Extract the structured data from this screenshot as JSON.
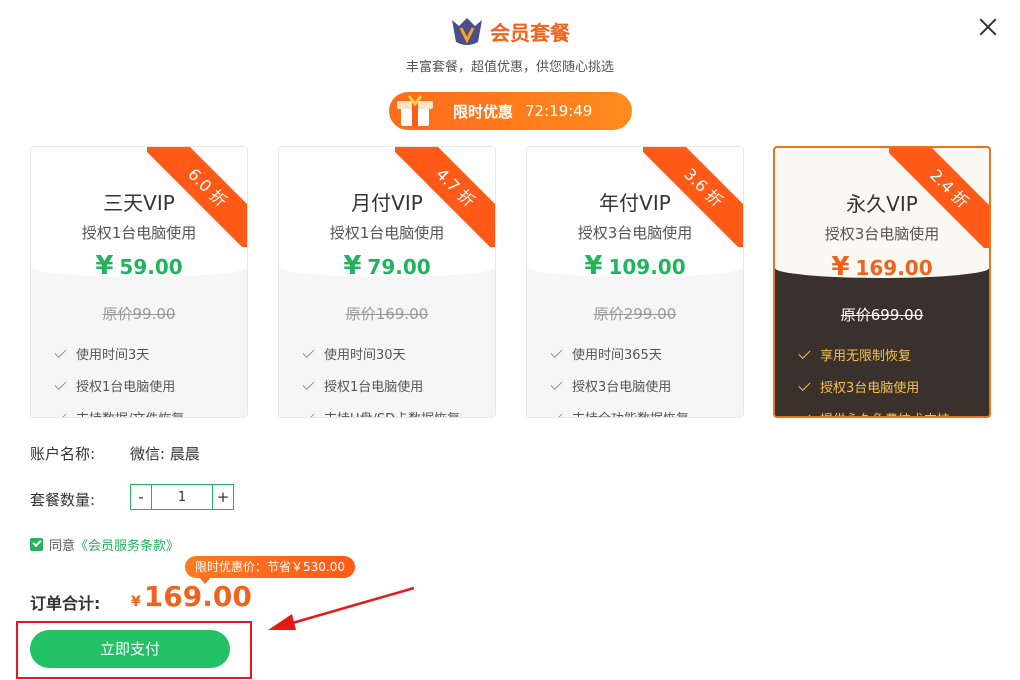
{
  "header": {
    "title": "会员套餐",
    "subtitle": "丰富套餐，超值优惠，供您随心挑选"
  },
  "promo": {
    "label": "限时优惠",
    "timer": "72:19:49"
  },
  "plans": [
    {
      "name": "三天VIP",
      "desc": "授权1台电脑使用",
      "yen": "¥",
      "price": "59.00",
      "orig": "原价99.00",
      "discount": "6.0 折",
      "features": [
        "使用时间3天",
        "授权1台电脑使用",
        "支持数据/文件恢复"
      ]
    },
    {
      "name": "月付VIP",
      "desc": "授权1台电脑使用",
      "yen": "¥",
      "price": "79.00",
      "orig": "原价169.00",
      "discount": "4.7 折",
      "features": [
        "使用时间30天",
        "授权1台电脑使用",
        "支持U盘/SD卡数据恢复"
      ]
    },
    {
      "name": "年付VIP",
      "desc": "授权3台电脑使用",
      "yen": "¥",
      "price": "109.00",
      "orig": "原价299.00",
      "discount": "3.6 折",
      "features": [
        "使用时间365天",
        "授权3台电脑使用",
        "支持全功能数据恢复"
      ]
    },
    {
      "name": "永久VIP",
      "desc": "授权3台电脑使用",
      "yen": "¥",
      "price": "169.00",
      "orig": "原价699.00",
      "discount": "2.4 折",
      "features": [
        "享用无限制恢复",
        "授权3台电脑使用",
        "提供永久免费技术支持"
      ]
    }
  ],
  "account": {
    "label": "账户名称:",
    "value": "微信: 晨晨"
  },
  "quantity": {
    "label": "套餐数量:",
    "minus": "-",
    "value": "1",
    "plus": "+"
  },
  "agreement": {
    "prefix": "同意",
    "terms": "《会员服务条款》"
  },
  "tooltip": "限时优惠价：节省￥530.00",
  "total": {
    "label": "订单合计:",
    "currency": "¥",
    "value": "169.00"
  },
  "pay_button": "立即支付",
  "colors": {
    "accent": "#22b45c",
    "orange": "#f0631c",
    "ribbon": "#ff5a17",
    "highlight": "#e8181a"
  }
}
